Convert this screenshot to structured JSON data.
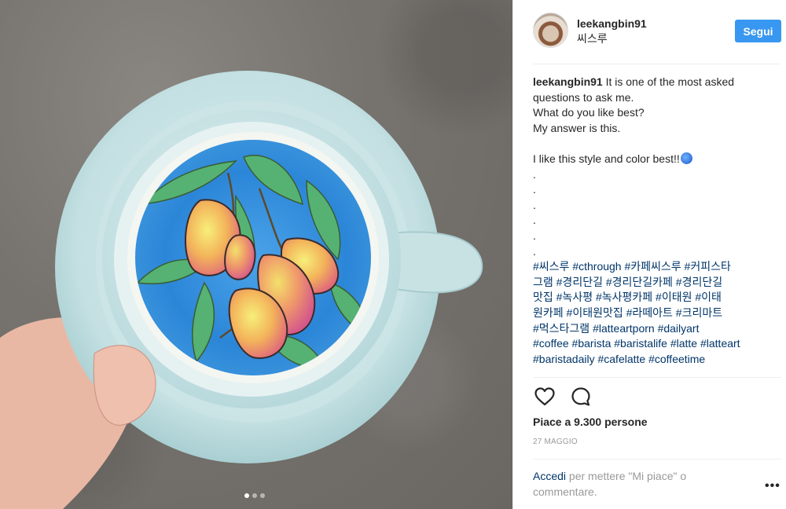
{
  "post": {
    "username": "leekangbin91",
    "location": "씨스루",
    "follow_label": "Segui",
    "caption_lines": [
      "It is one of the most asked",
      "questions to ask me.",
      "What do you like best?",
      "My answer is this.",
      "",
      "I like this style and color best!!"
    ],
    "dot_lines": [
      ".",
      ".",
      ".",
      ".",
      ".",
      "."
    ],
    "hashtag_lines": [
      "#씨스루 #cthrough #카페씨스루 #커피스타",
      "그램 #경리단길 #경리단길카페 #경리단길",
      "맛집 #녹사평 #녹사평카페 #이태원 #이태",
      "원카페 #이태원맛집 #라떼아트 #크리마트",
      "#먹스타그램 #latteartporn #dailyart",
      "#coffee #barista #baristalife #latte #latteart",
      "#baristadaily #cafelatte #coffeetime"
    ],
    "likes": "Piace a 9.300 persone",
    "date": "27 maggio",
    "login_link": "Accedi",
    "login_text": "per mettere \"Mi piace\" o commentare.",
    "more_label": "•••"
  },
  "media": {
    "slide_count": 3,
    "active_slide": 1
  },
  "icons": {
    "like": "heart-icon",
    "comment": "comment-icon",
    "caption_emoji": "gem-icon"
  },
  "colors": {
    "accent": "#3897f0",
    "link": "#003569",
    "muted": "#999999",
    "text": "#262626"
  }
}
